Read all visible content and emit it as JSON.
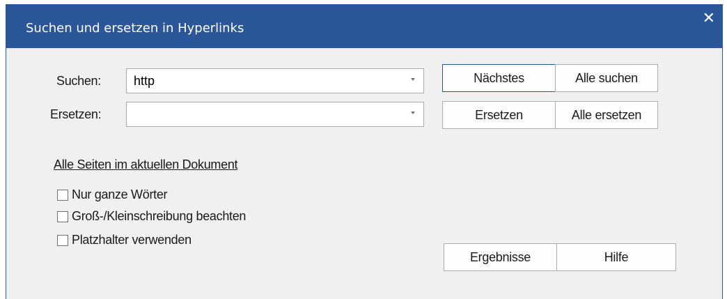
{
  "dialog": {
    "title": "Suchen und ersetzen in Hyperlinks",
    "close_glyph": "✕"
  },
  "search": {
    "label": "Suchen:",
    "value": "http"
  },
  "replace": {
    "label": "Ersetzen:",
    "value": ""
  },
  "buttons": {
    "next": "Nächstes",
    "find_all": "Alle suchen",
    "replace": "Ersetzen",
    "replace_all": "Alle ersetzen",
    "results": "Ergebnisse",
    "help": "Hilfe"
  },
  "scope_link": "Alle Seiten im aktuellen Dokument",
  "options": [
    {
      "label": "Nur ganze Wörter",
      "checked": false
    },
    {
      "label": "Groß-/Kleinschreibung beachten",
      "checked": false
    },
    {
      "label": "Platzhalter verwenden",
      "checked": false
    }
  ],
  "colors": {
    "titlebar": "#2b579a",
    "dialog_bg": "#f0f0f0"
  }
}
